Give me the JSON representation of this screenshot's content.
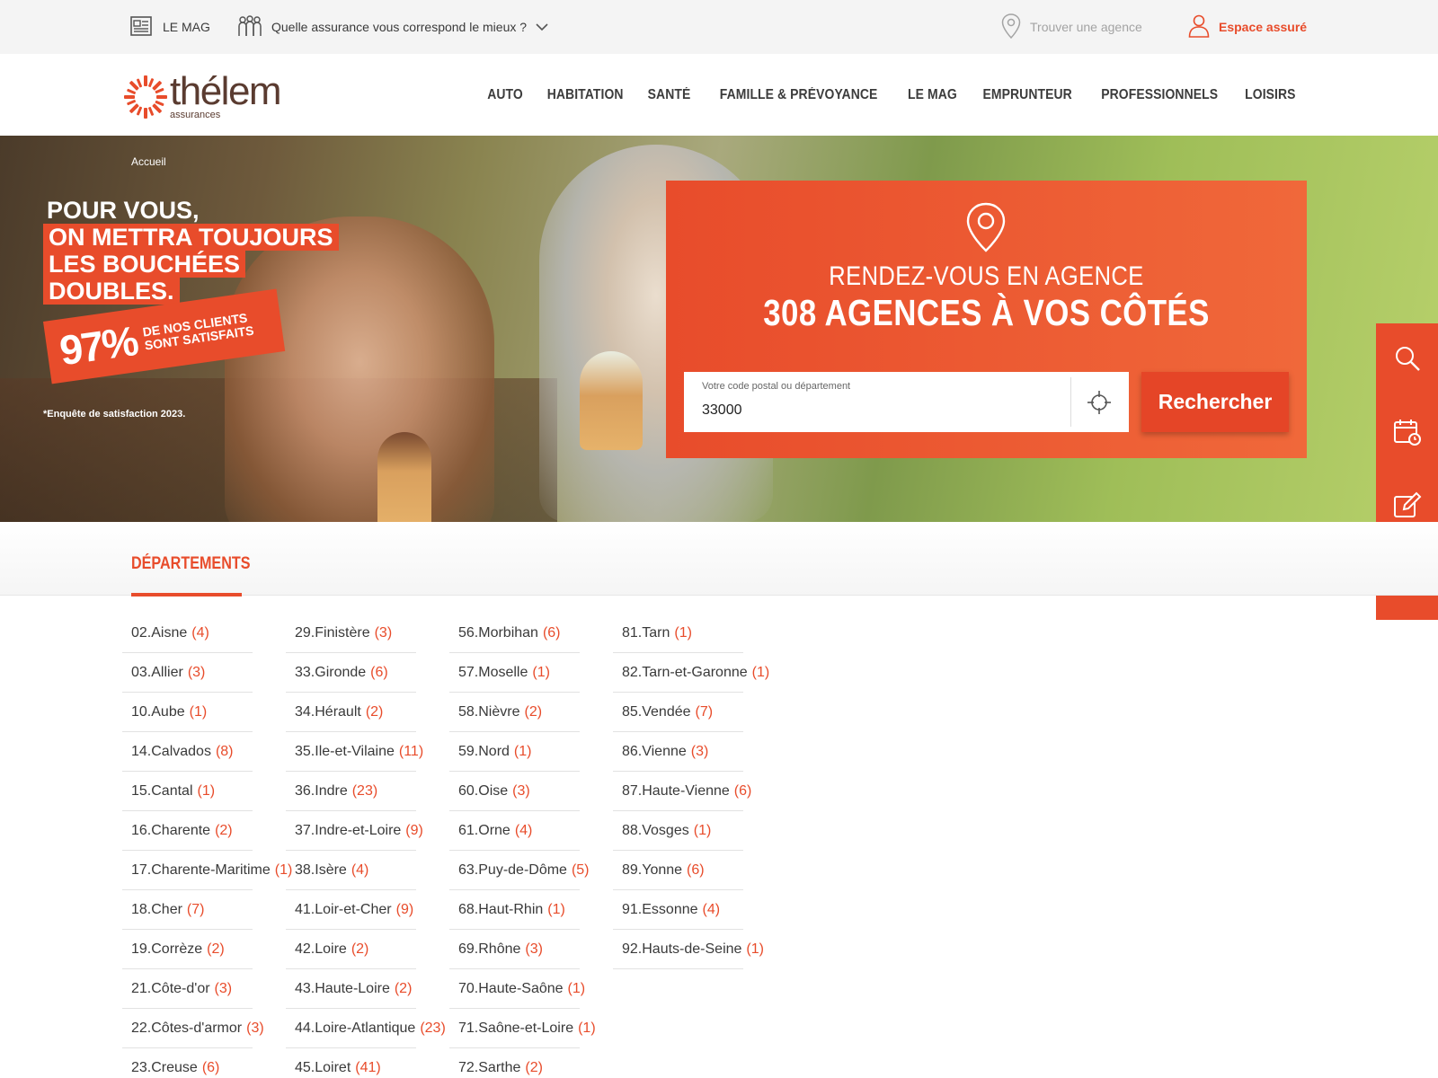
{
  "topbar": {
    "mag_label": "LE MAG",
    "quelle_label": "Quelle assurance vous correspond le mieux ?",
    "agence_label": "Trouver une agence",
    "espace_label": "Espace assuré"
  },
  "brand": {
    "name": "thélem",
    "sub": "assurances"
  },
  "nav": [
    "AUTO",
    "HABITATION",
    "SANTÉ",
    "FAMILLE & PRÉVOYANCE",
    "LE MAG",
    "EMPRUNTEUR",
    "PROFESSIONNELS",
    "LOISIRS"
  ],
  "hero": {
    "breadcrumb": "Accueil",
    "slogan": [
      "POUR VOUS,",
      "ON METTRA TOUJOURS",
      "LES BOUCHÉES",
      "DOUBLES."
    ],
    "badge_pct": "97%",
    "badge_text": "DE NOS CLIENTS SONT SATISFAITS",
    "enquete": "*Enquête de satisfaction 2023."
  },
  "panel": {
    "title1": "RENDEZ-VOUS EN AGENCE",
    "title2": "308 AGENCES À VOS CÔTÉS",
    "input_label": "Votre code postal ou département",
    "input_value": "33000",
    "button": "Rechercher"
  },
  "tabs": {
    "active": "DÉPARTEMENTS"
  },
  "colors": {
    "accent": "#e84c2b",
    "brand_brown": "#5a3b30"
  },
  "rail_icons": [
    "search-icon",
    "calendar-icon",
    "edit-icon",
    "lightning-icon"
  ],
  "departements": [
    [
      {
        "name": "02.Aisne",
        "count": "(4)"
      },
      {
        "name": "03.Allier",
        "count": "(3)"
      },
      {
        "name": "10.Aube",
        "count": "(1)"
      },
      {
        "name": "14.Calvados",
        "count": "(8)"
      },
      {
        "name": "15.Cantal",
        "count": "(1)"
      },
      {
        "name": "16.Charente",
        "count": "(2)"
      },
      {
        "name": "17.Charente-Maritime",
        "count": "(1)"
      },
      {
        "name": "18.Cher",
        "count": "(7)"
      },
      {
        "name": "19.Corrèze",
        "count": "(2)"
      },
      {
        "name": "21.Côte-d'or",
        "count": "(3)"
      },
      {
        "name": "22.Côtes-d'armor",
        "count": "(3)"
      },
      {
        "name": "23.Creuse",
        "count": "(6)"
      }
    ],
    [
      {
        "name": "29.Finistère",
        "count": "(3)"
      },
      {
        "name": "33.Gironde",
        "count": "(6)"
      },
      {
        "name": "34.Hérault",
        "count": "(2)"
      },
      {
        "name": "35.Ile-et-Vilaine",
        "count": "(11)"
      },
      {
        "name": "36.Indre",
        "count": "(23)"
      },
      {
        "name": "37.Indre-et-Loire",
        "count": "(9)"
      },
      {
        "name": "38.Isère",
        "count": "(4)"
      },
      {
        "name": "41.Loir-et-Cher",
        "count": "(9)"
      },
      {
        "name": "42.Loire",
        "count": "(2)"
      },
      {
        "name": "43.Haute-Loire",
        "count": "(2)"
      },
      {
        "name": "44.Loire-Atlantique",
        "count": "(23)"
      },
      {
        "name": "45.Loiret",
        "count": "(41)"
      }
    ],
    [
      {
        "name": "56.Morbihan",
        "count": "(6)"
      },
      {
        "name": "57.Moselle",
        "count": "(1)"
      },
      {
        "name": "58.Nièvre",
        "count": "(2)"
      },
      {
        "name": "59.Nord",
        "count": "(1)"
      },
      {
        "name": "60.Oise",
        "count": "(3)"
      },
      {
        "name": "61.Orne",
        "count": "(4)"
      },
      {
        "name": "63.Puy-de-Dôme",
        "count": "(5)"
      },
      {
        "name": "68.Haut-Rhin",
        "count": "(1)"
      },
      {
        "name": "69.Rhône",
        "count": "(3)"
      },
      {
        "name": "70.Haute-Saône",
        "count": "(1)"
      },
      {
        "name": "71.Saône-et-Loire",
        "count": "(1)"
      },
      {
        "name": "72.Sarthe",
        "count": "(2)"
      }
    ],
    [
      {
        "name": "81.Tarn",
        "count": "(1)"
      },
      {
        "name": "82.Tarn-et-Garonne",
        "count": "(1)"
      },
      {
        "name": "85.Vendée",
        "count": "(7)"
      },
      {
        "name": "86.Vienne",
        "count": "(3)"
      },
      {
        "name": "87.Haute-Vienne",
        "count": "(6)"
      },
      {
        "name": "88.Vosges",
        "count": "(1)"
      },
      {
        "name": "89.Yonne",
        "count": "(6)"
      },
      {
        "name": "91.Essonne",
        "count": "(4)"
      },
      {
        "name": "92.Hauts-de-Seine",
        "count": "(1)"
      }
    ]
  ]
}
